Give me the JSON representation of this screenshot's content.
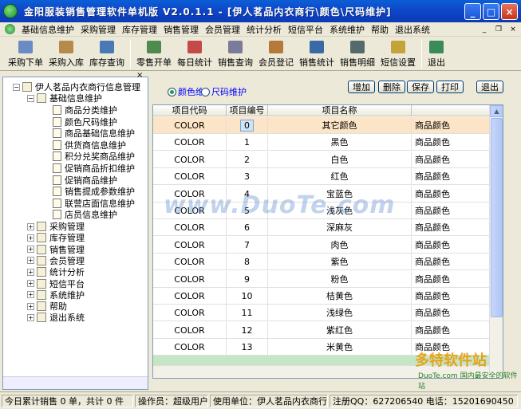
{
  "window": {
    "title": "金阳服装销售管理软件单机版  V2.0.1.1 - [伊人茗品内衣商行\\颜色\\尺码维护]"
  },
  "menu": [
    "基础信息维护",
    "采购管理",
    "库存管理",
    "销售管理",
    "会员管理",
    "统计分析",
    "短信平台",
    "系统维护",
    "帮助",
    "退出系统"
  ],
  "toolbar": [
    {
      "label": "采购下单",
      "icon": "purchase-order-icon",
      "color": "#6a8bc4"
    },
    {
      "label": "采购入库",
      "icon": "purchase-in-icon",
      "color": "#b58a4a"
    },
    {
      "label": "库存查询",
      "icon": "stock-query-icon",
      "color": "#4a7ab5"
    },
    {
      "label": "零售开单",
      "icon": "retail-order-icon",
      "color": "#4f8a4f"
    },
    {
      "label": "每日统计",
      "icon": "daily-stat-icon",
      "color": "#c44a4a"
    },
    {
      "label": "销售查询",
      "icon": "sales-query-icon",
      "color": "#7a7a9a"
    },
    {
      "label": "会员登记",
      "icon": "member-register-icon",
      "color": "#b57a3a"
    },
    {
      "label": "销售统计",
      "icon": "sales-stat-icon",
      "color": "#3a6aa5"
    },
    {
      "label": "销售明细",
      "icon": "sales-detail-icon",
      "color": "#556a6a"
    },
    {
      "label": "短信设置",
      "icon": "sms-settings-icon",
      "color": "#c4a43a"
    },
    {
      "label": "退出",
      "icon": "exit-icon",
      "color": "#3a8a5a"
    }
  ],
  "tree": {
    "root": "伊人茗品内衣商行信息管理",
    "base": "基础信息维护",
    "base_children": [
      "商品分类维护",
      "颜色尺码维护",
      "商品基础信息维护",
      "供货商信息维护",
      "积分兑奖商品维护",
      "促销商品折扣维护",
      "促销商品维护",
      "销售提成参数维护",
      "联营店面信息维护",
      "店员信息维护"
    ],
    "others": [
      "采购管理",
      "库存管理",
      "销售管理",
      "会员管理",
      "统计分析",
      "短信平台",
      "系统维护",
      "帮助",
      "退出系统"
    ]
  },
  "options": {
    "color": "颜色维护",
    "size": "尺码维护"
  },
  "actions": {
    "add": "增加",
    "del": "删除",
    "save": "保存",
    "print": "打印",
    "exit": "退出"
  },
  "grid": {
    "headers": [
      "项目代码",
      "项目编号",
      "项目名称",
      ""
    ],
    "rows": [
      [
        "COLOR",
        "0",
        "其它颜色",
        "商品颜色"
      ],
      [
        "COLOR",
        "1",
        "黑色",
        "商品颜色"
      ],
      [
        "COLOR",
        "2",
        "白色",
        "商品颜色"
      ],
      [
        "COLOR",
        "3",
        "红色",
        "商品颜色"
      ],
      [
        "COLOR",
        "4",
        "宝蓝色",
        "商品颜色"
      ],
      [
        "COLOR",
        "5",
        "浅灰色",
        "商品颜色"
      ],
      [
        "COLOR",
        "6",
        "深麻灰",
        "商品颜色"
      ],
      [
        "COLOR",
        "7",
        "肉色",
        "商品颜色"
      ],
      [
        "COLOR",
        "8",
        "紫色",
        "商品颜色"
      ],
      [
        "COLOR",
        "9",
        "粉色",
        "商品颜色"
      ],
      [
        "COLOR",
        "10",
        "桔黄色",
        "商品颜色"
      ],
      [
        "COLOR",
        "11",
        "浅绿色",
        "商品颜色"
      ],
      [
        "COLOR",
        "12",
        "紫红色",
        "商品颜色"
      ],
      [
        "COLOR",
        "13",
        "米黄色",
        "商品颜色"
      ]
    ]
  },
  "status": {
    "today": "今日累计销售 0 单，共计 0 件",
    "operator": "操作员：超级用户",
    "unit": "使用单位：伊人茗品内衣商行",
    "reg": "注册QQ：627206540 电话：15201690450"
  },
  "watermark": {
    "main": "www.DuoTe.com",
    "corner": "多特软件站",
    "corner_sub": "DuoTe.com 国内最安全的软件站"
  }
}
